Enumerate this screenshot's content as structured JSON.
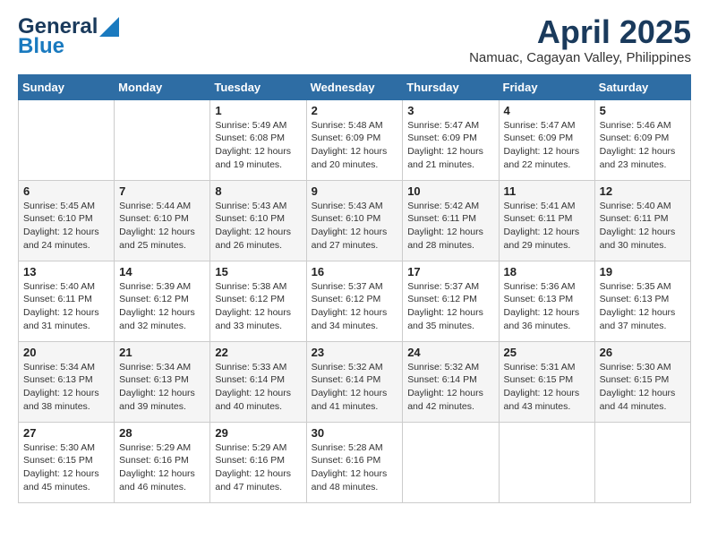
{
  "logo": {
    "line1": "General",
    "line2": "Blue"
  },
  "title": "April 2025",
  "location": "Namuac, Cagayan Valley, Philippines",
  "days_header": [
    "Sunday",
    "Monday",
    "Tuesday",
    "Wednesday",
    "Thursday",
    "Friday",
    "Saturday"
  ],
  "weeks": [
    [
      {
        "day": "",
        "info": ""
      },
      {
        "day": "",
        "info": ""
      },
      {
        "day": "1",
        "info": "Sunrise: 5:49 AM\nSunset: 6:08 PM\nDaylight: 12 hours\nand 19 minutes."
      },
      {
        "day": "2",
        "info": "Sunrise: 5:48 AM\nSunset: 6:09 PM\nDaylight: 12 hours\nand 20 minutes."
      },
      {
        "day": "3",
        "info": "Sunrise: 5:47 AM\nSunset: 6:09 PM\nDaylight: 12 hours\nand 21 minutes."
      },
      {
        "day": "4",
        "info": "Sunrise: 5:47 AM\nSunset: 6:09 PM\nDaylight: 12 hours\nand 22 minutes."
      },
      {
        "day": "5",
        "info": "Sunrise: 5:46 AM\nSunset: 6:09 PM\nDaylight: 12 hours\nand 23 minutes."
      }
    ],
    [
      {
        "day": "6",
        "info": "Sunrise: 5:45 AM\nSunset: 6:10 PM\nDaylight: 12 hours\nand 24 minutes."
      },
      {
        "day": "7",
        "info": "Sunrise: 5:44 AM\nSunset: 6:10 PM\nDaylight: 12 hours\nand 25 minutes."
      },
      {
        "day": "8",
        "info": "Sunrise: 5:43 AM\nSunset: 6:10 PM\nDaylight: 12 hours\nand 26 minutes."
      },
      {
        "day": "9",
        "info": "Sunrise: 5:43 AM\nSunset: 6:10 PM\nDaylight: 12 hours\nand 27 minutes."
      },
      {
        "day": "10",
        "info": "Sunrise: 5:42 AM\nSunset: 6:11 PM\nDaylight: 12 hours\nand 28 minutes."
      },
      {
        "day": "11",
        "info": "Sunrise: 5:41 AM\nSunset: 6:11 PM\nDaylight: 12 hours\nand 29 minutes."
      },
      {
        "day": "12",
        "info": "Sunrise: 5:40 AM\nSunset: 6:11 PM\nDaylight: 12 hours\nand 30 minutes."
      }
    ],
    [
      {
        "day": "13",
        "info": "Sunrise: 5:40 AM\nSunset: 6:11 PM\nDaylight: 12 hours\nand 31 minutes."
      },
      {
        "day": "14",
        "info": "Sunrise: 5:39 AM\nSunset: 6:12 PM\nDaylight: 12 hours\nand 32 minutes."
      },
      {
        "day": "15",
        "info": "Sunrise: 5:38 AM\nSunset: 6:12 PM\nDaylight: 12 hours\nand 33 minutes."
      },
      {
        "day": "16",
        "info": "Sunrise: 5:37 AM\nSunset: 6:12 PM\nDaylight: 12 hours\nand 34 minutes."
      },
      {
        "day": "17",
        "info": "Sunrise: 5:37 AM\nSunset: 6:12 PM\nDaylight: 12 hours\nand 35 minutes."
      },
      {
        "day": "18",
        "info": "Sunrise: 5:36 AM\nSunset: 6:13 PM\nDaylight: 12 hours\nand 36 minutes."
      },
      {
        "day": "19",
        "info": "Sunrise: 5:35 AM\nSunset: 6:13 PM\nDaylight: 12 hours\nand 37 minutes."
      }
    ],
    [
      {
        "day": "20",
        "info": "Sunrise: 5:34 AM\nSunset: 6:13 PM\nDaylight: 12 hours\nand 38 minutes."
      },
      {
        "day": "21",
        "info": "Sunrise: 5:34 AM\nSunset: 6:13 PM\nDaylight: 12 hours\nand 39 minutes."
      },
      {
        "day": "22",
        "info": "Sunrise: 5:33 AM\nSunset: 6:14 PM\nDaylight: 12 hours\nand 40 minutes."
      },
      {
        "day": "23",
        "info": "Sunrise: 5:32 AM\nSunset: 6:14 PM\nDaylight: 12 hours\nand 41 minutes."
      },
      {
        "day": "24",
        "info": "Sunrise: 5:32 AM\nSunset: 6:14 PM\nDaylight: 12 hours\nand 42 minutes."
      },
      {
        "day": "25",
        "info": "Sunrise: 5:31 AM\nSunset: 6:15 PM\nDaylight: 12 hours\nand 43 minutes."
      },
      {
        "day": "26",
        "info": "Sunrise: 5:30 AM\nSunset: 6:15 PM\nDaylight: 12 hours\nand 44 minutes."
      }
    ],
    [
      {
        "day": "27",
        "info": "Sunrise: 5:30 AM\nSunset: 6:15 PM\nDaylight: 12 hours\nand 45 minutes."
      },
      {
        "day": "28",
        "info": "Sunrise: 5:29 AM\nSunset: 6:16 PM\nDaylight: 12 hours\nand 46 minutes."
      },
      {
        "day": "29",
        "info": "Sunrise: 5:29 AM\nSunset: 6:16 PM\nDaylight: 12 hours\nand 47 minutes."
      },
      {
        "day": "30",
        "info": "Sunrise: 5:28 AM\nSunset: 6:16 PM\nDaylight: 12 hours\nand 48 minutes."
      },
      {
        "day": "",
        "info": ""
      },
      {
        "day": "",
        "info": ""
      },
      {
        "day": "",
        "info": ""
      }
    ]
  ]
}
